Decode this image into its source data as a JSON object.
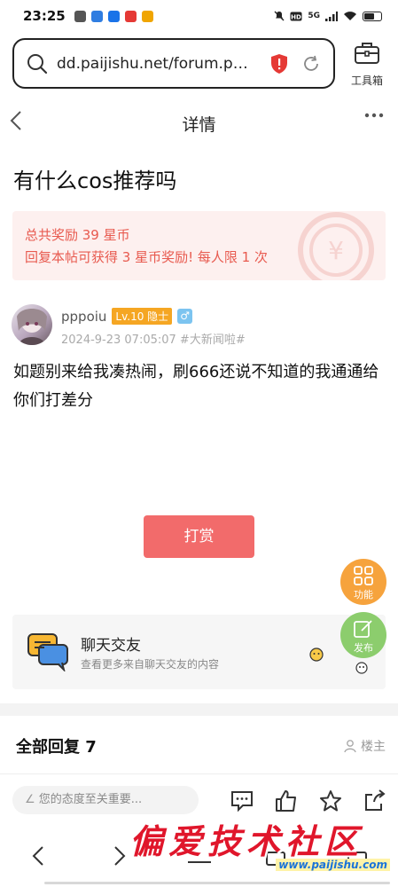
{
  "status_bar": {
    "time": "23:25",
    "network": "5G",
    "app_colors": [
      "#555555",
      "#2f7de1",
      "#1a73e8",
      "#e53935",
      "#f0a500"
    ]
  },
  "browser": {
    "url": "dd.paijishu.net/forum.p…",
    "toolbox_label": "工具箱"
  },
  "header": {
    "title": "详情"
  },
  "post": {
    "title": "有什么cos推荐吗",
    "reward_line1": "总共奖励 39 星币",
    "reward_line2": "回复本帖可获得 3 星币奖励! 每人限 1 次",
    "author": {
      "name": "pppoiu",
      "level": "Lv.10 隐士",
      "gender": "♂",
      "meta": "2024-9-23 07:05:07 #大新闻啦#"
    },
    "content": "如题别来给我凑热闹，刷666还说不知道的我通通给你们打差分",
    "tip_button": "打赏"
  },
  "fab": {
    "function_label": "功能",
    "publish_label": "发布"
  },
  "chat_card": {
    "title": "聊天交友",
    "subtitle": "查看更多来自聊天交友的内容"
  },
  "replies": {
    "header": "全部回复 7",
    "owner_filter": "楼主"
  },
  "action_bar": {
    "reply_placeholder": "您的态度至关重要..."
  },
  "watermark": {
    "text": "偏爱技术社区",
    "url": "www.paijishu.com"
  },
  "colors": {
    "accent_red": "#f26b6b",
    "reward_text": "#e85a4f",
    "level_badge": "#f5a623",
    "fab_orange": "#f6a33d",
    "fab_green": "#8ccd6d"
  }
}
